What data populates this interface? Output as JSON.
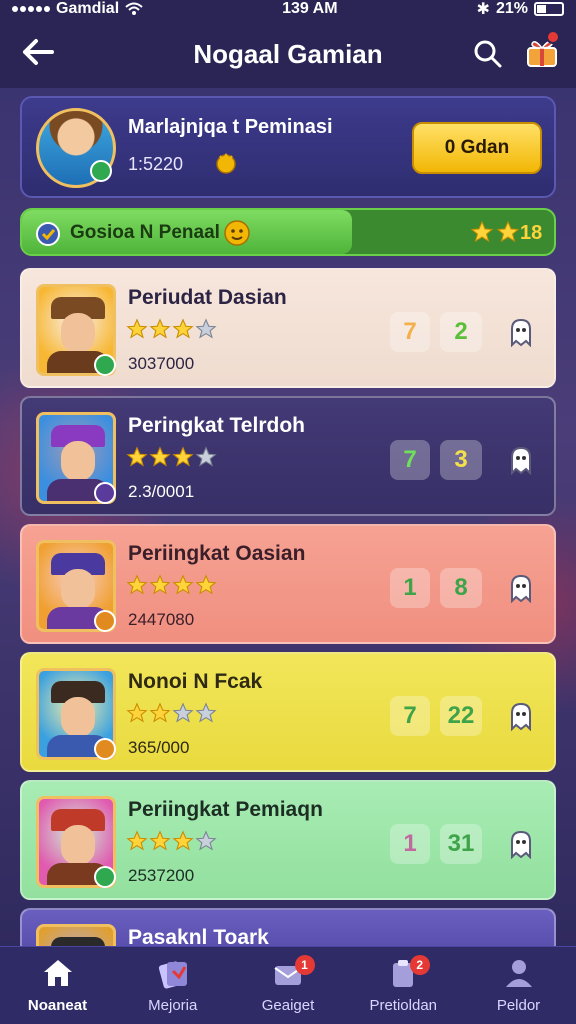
{
  "status_bar": {
    "carrier": "Gamdial",
    "time": "139 AM",
    "battery": "21%"
  },
  "header": {
    "title": "Nogaal Gamian"
  },
  "profile": {
    "name": "Marlajnjqa t Peminasi",
    "score": "1:5220",
    "button_label": "0 Gdan"
  },
  "progress": {
    "label": "Gosioa N Penaal",
    "count": "18",
    "fill_percent": 62
  },
  "leaderboard": [
    {
      "name": "Periudat Dasian",
      "stars": 3,
      "points": "3037000",
      "level": "7",
      "count": "2",
      "level_color": "#f3b04a",
      "count_color": "#5bbf3a",
      "badge_color": "#2fa84f",
      "hat_color": "#7a4a22",
      "body_color": "#6b3b1d",
      "bg_color": "#f7b733"
    },
    {
      "name": "Peringkat Telrdoh",
      "stars": 3,
      "points": "2.3/0001",
      "level": "7",
      "count": "3",
      "level_color": "#6fe05a",
      "count_color": "#f4e04a",
      "badge_color": "#5a3a9a",
      "hat_color": "#8a3ac0",
      "body_color": "#4a3070",
      "bg_color": "#3a8fe0"
    },
    {
      "name": "Periingkat Oasian",
      "stars": 4,
      "points": "2447080",
      "level": "1",
      "count": "8",
      "level_color": "#3fa34a",
      "count_color": "#3fa34a",
      "badge_color": "#e08a20",
      "hat_color": "#4a3aa0",
      "body_color": "#6a3aa0",
      "bg_color": "#f0a030"
    },
    {
      "name": "Nonoi N Fcak",
      "stars": 2,
      "points": "365/000",
      "level": "7",
      "count": "22",
      "level_color": "#3fa34a",
      "count_color": "#3fa34a",
      "badge_color": "#e08a20",
      "hat_color": "#3a2a20",
      "body_color": "#3a5ab0",
      "bg_color": "#3aa0e0"
    },
    {
      "name": "Periingkat Pemiaqn",
      "stars": 3,
      "points": "2537200",
      "level": "1",
      "count": "31",
      "level_color": "#c06aa0",
      "count_color": "#3fa34a",
      "badge_color": "#2fa84f",
      "hat_color": "#c03a2a",
      "body_color": "#7a3a20",
      "bg_color": "#e05ab0"
    },
    {
      "name": "Pasaknl Toark",
      "stars": 0,
      "points": "",
      "level": "",
      "count": "",
      "level_color": "#ffffff",
      "count_color": "#ffffff",
      "badge_color": "#2fa84f",
      "hat_color": "#2a2a2a",
      "body_color": "#3a3a3a",
      "bg_color": "#e0a030"
    }
  ],
  "bottom_nav": [
    {
      "label": "Noaneat",
      "icon": "home-icon",
      "badge": ""
    },
    {
      "label": "Mejoria",
      "icon": "cards-icon",
      "badge": ""
    },
    {
      "label": "Geaiget",
      "icon": "mail-icon",
      "badge": "1"
    },
    {
      "label": "Pretioldan",
      "icon": "clipboard-icon",
      "badge": "2"
    },
    {
      "label": "Peldor",
      "icon": "profile-icon",
      "badge": ""
    }
  ],
  "colors": {
    "accent": "#f2b705",
    "background": "#2a2554",
    "progress_green": "#4fb43a"
  }
}
